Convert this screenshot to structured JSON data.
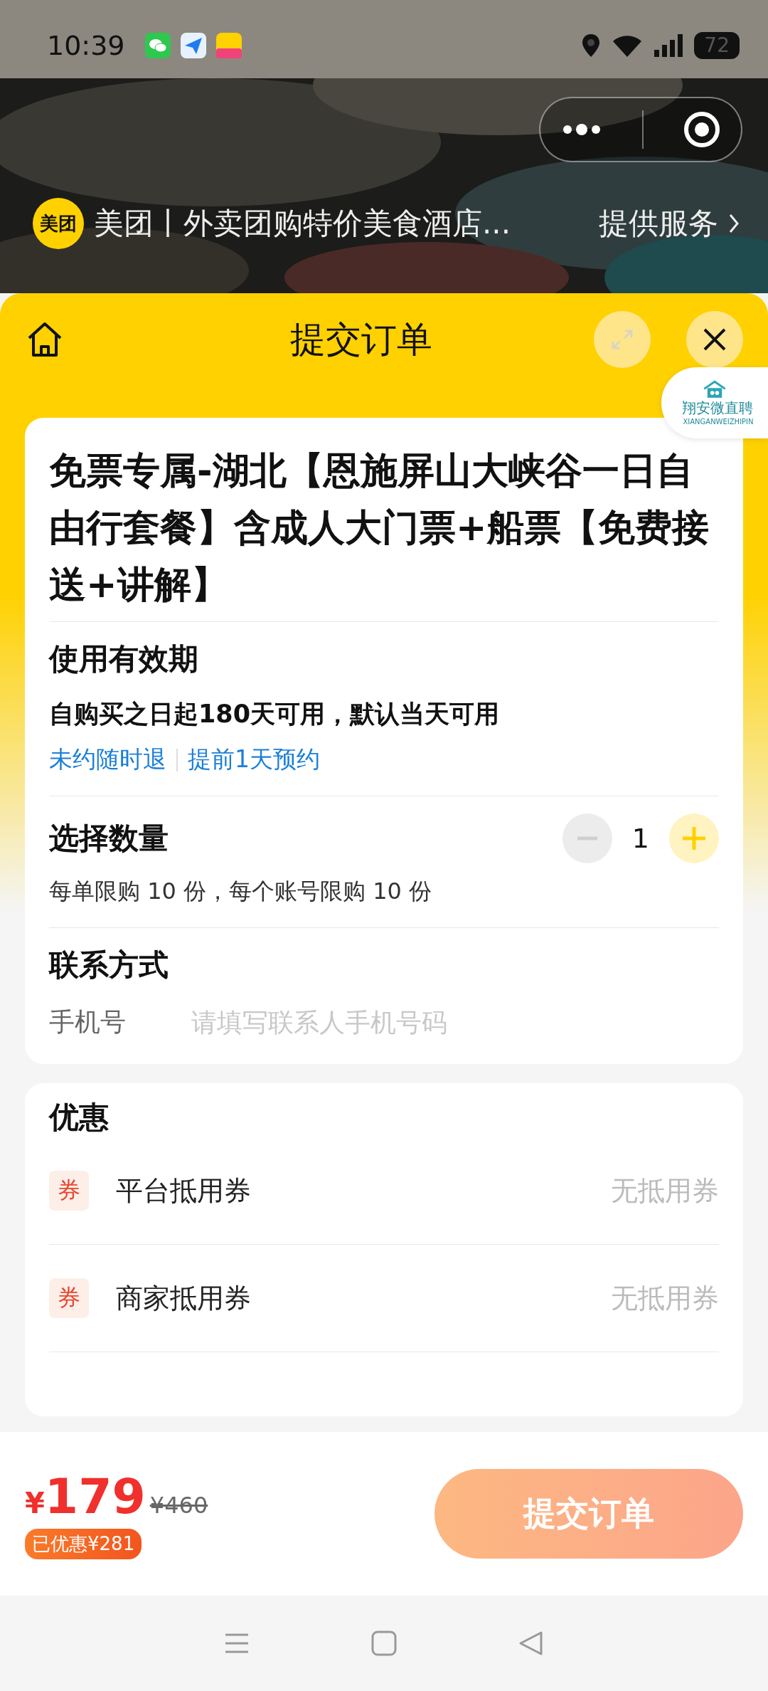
{
  "status_bar": {
    "time": "10:39",
    "battery": "72"
  },
  "mini_program": {
    "logo": "美团",
    "name": "美团丨外卖团购特价美食酒店...",
    "service_link": "提供服务"
  },
  "header": {
    "title": "提交订单"
  },
  "floating_badge": {
    "label": "翔安微直聘",
    "sublabel": "XIANGANWEIZHIPIN"
  },
  "product": {
    "title": "免票专属-湖北【恩施屏山大峡谷一日自由行套餐】含成人大门票+船票【免费接送+讲解】",
    "validity_heading": "使用有效期",
    "validity_text": "自购买之日起180天可用，默认当天可用",
    "policies": [
      "未约随时退",
      "提前1天预约"
    ]
  },
  "quantity": {
    "heading": "选择数量",
    "value": "1",
    "minus_disabled": true,
    "limit_note": "每单限购 10 份，每个账号限购 10 份"
  },
  "contact": {
    "heading": "联系方式",
    "field_label": "手机号",
    "placeholder": "请填写联系人手机号码"
  },
  "discounts": {
    "heading": "优惠",
    "items": [
      {
        "badge": "券",
        "label": "平台抵用券",
        "value": "无抵用券"
      },
      {
        "badge": "券",
        "label": "商家抵用券",
        "value": "无抵用券"
      }
    ]
  },
  "footer": {
    "price_symbol": "¥",
    "price": "179",
    "original_price": "¥460",
    "saved": "已优惠¥281",
    "submit": "提交订单"
  }
}
